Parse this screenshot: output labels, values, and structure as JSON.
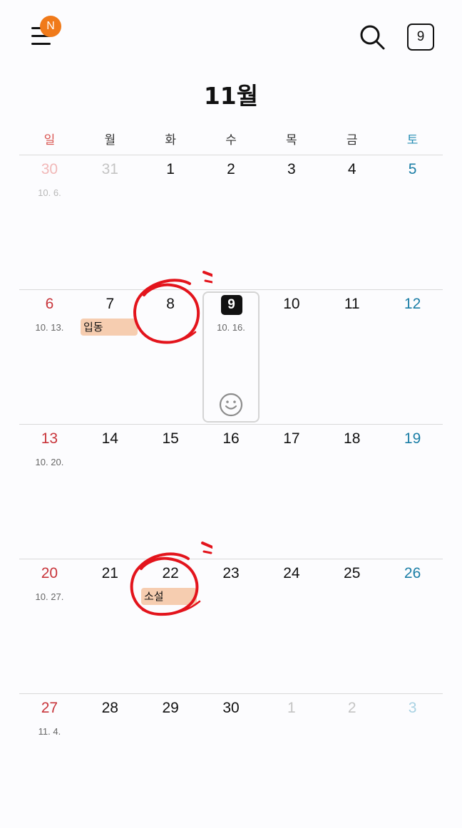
{
  "header": {
    "menu_badge": "N",
    "today_button": "9",
    "month_title": "11월"
  },
  "weekdays": [
    "일",
    "월",
    "화",
    "수",
    "목",
    "금",
    "토"
  ],
  "weeks": [
    [
      {
        "day": "30",
        "lunar": "10. 6.",
        "other": true
      },
      {
        "day": "31",
        "lunar": "",
        "other": true
      },
      {
        "day": "1",
        "lunar": ""
      },
      {
        "day": "2",
        "lunar": ""
      },
      {
        "day": "3",
        "lunar": ""
      },
      {
        "day": "4",
        "lunar": ""
      },
      {
        "day": "5",
        "lunar": ""
      }
    ],
    [
      {
        "day": "6",
        "lunar": "10. 13."
      },
      {
        "day": "7",
        "lunar": ""
      },
      {
        "day": "8",
        "lunar": ""
      },
      {
        "day": "9",
        "lunar": "10. 16.",
        "today": true
      },
      {
        "day": "10",
        "lunar": ""
      },
      {
        "day": "11",
        "lunar": ""
      },
      {
        "day": "12",
        "lunar": ""
      }
    ],
    [
      {
        "day": "13",
        "lunar": "10. 20."
      },
      {
        "day": "14",
        "lunar": ""
      },
      {
        "day": "15",
        "lunar": ""
      },
      {
        "day": "16",
        "lunar": ""
      },
      {
        "day": "17",
        "lunar": ""
      },
      {
        "day": "18",
        "lunar": ""
      },
      {
        "day": "19",
        "lunar": ""
      }
    ],
    [
      {
        "day": "20",
        "lunar": "10. 27."
      },
      {
        "day": "21",
        "lunar": ""
      },
      {
        "day": "22",
        "lunar": ""
      },
      {
        "day": "23",
        "lunar": ""
      },
      {
        "day": "24",
        "lunar": ""
      },
      {
        "day": "25",
        "lunar": ""
      },
      {
        "day": "26",
        "lunar": ""
      }
    ],
    [
      {
        "day": "27",
        "lunar": "11. 4."
      },
      {
        "day": "28",
        "lunar": ""
      },
      {
        "day": "29",
        "lunar": ""
      },
      {
        "day": "30",
        "lunar": ""
      },
      {
        "day": "1",
        "lunar": "",
        "other": true
      },
      {
        "day": "2",
        "lunar": "",
        "other": true
      },
      {
        "day": "3",
        "lunar": "",
        "other": true
      }
    ]
  ],
  "events": {
    "ipdong": "입동",
    "soseol": "소설"
  },
  "colors": {
    "sunday": "#c8343a",
    "saturday": "#1b7ea6",
    "event_bg": "#f6cdb0",
    "badge": "#f07a1a",
    "annotation": "#e3141c"
  },
  "icons": {
    "menu": "hamburger-menu-icon",
    "search": "search-icon",
    "today": "today-calendar-icon",
    "sticker": "smiley-face-icon"
  }
}
